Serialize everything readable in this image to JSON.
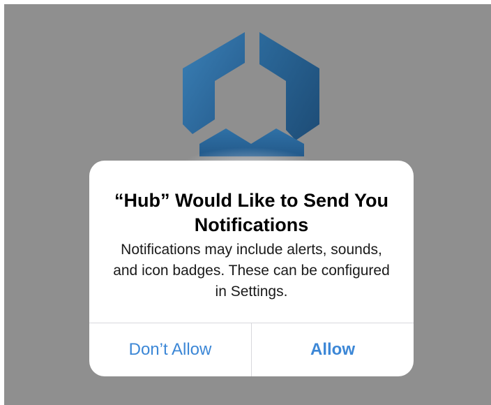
{
  "app": {
    "icon": "hub-hexagon-logo-icon",
    "colors": {
      "logo_blue": "#2f6e9e",
      "logo_dark": "#1f4f78",
      "screen_dim": "#8f8f8f",
      "accent": "#3c87d6"
    }
  },
  "alert": {
    "title": "“Hub” Would Like to Send You Notifications",
    "message": "Notifications may include alerts, sounds, and icon badges. These can be configured in Settings.",
    "buttons": {
      "dont_allow": "Don’t Allow",
      "allow": "Allow"
    }
  }
}
